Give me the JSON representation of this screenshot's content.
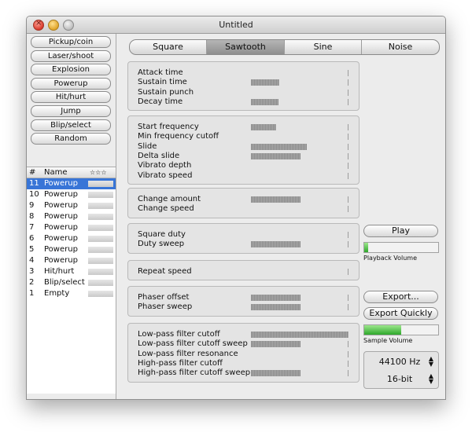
{
  "window": {
    "title": "Untitled"
  },
  "generators": [
    "Pickup/coin",
    "Laser/shoot",
    "Explosion",
    "Powerup",
    "Hit/hurt",
    "Jump",
    "Blip/select",
    "Random"
  ],
  "sound_list": {
    "headers": {
      "num": "#",
      "name": "Name",
      "rating": "☆☆☆"
    },
    "rows": [
      {
        "num": "11",
        "name": "Powerup"
      },
      {
        "num": "10",
        "name": "Powerup"
      },
      {
        "num": "9",
        "name": "Powerup"
      },
      {
        "num": "8",
        "name": "Powerup"
      },
      {
        "num": "7",
        "name": "Powerup"
      },
      {
        "num": "6",
        "name": "Powerup"
      },
      {
        "num": "5",
        "name": "Powerup"
      },
      {
        "num": "4",
        "name": "Powerup"
      },
      {
        "num": "3",
        "name": "Hit/hurt"
      },
      {
        "num": "2",
        "name": "Blip/select"
      },
      {
        "num": "1",
        "name": "Empty"
      }
    ],
    "selected_index": 0,
    "remove_label": "−"
  },
  "waveforms": [
    "Square",
    "Sawtooth",
    "Sine",
    "Noise"
  ],
  "selected_waveform": 1,
  "groups": [
    {
      "params": [
        {
          "label": "Attack time",
          "value": 0
        },
        {
          "label": "Sustain time",
          "value": 0.29
        },
        {
          "label": "Sustain punch",
          "value": 0
        },
        {
          "label": "Decay time",
          "value": 0.28
        }
      ]
    },
    {
      "params": [
        {
          "label": "Start frequency",
          "value": 0.26
        },
        {
          "label": "Min frequency cutoff",
          "value": 0
        },
        {
          "label": "Slide",
          "value": 0.57,
          "center": true
        },
        {
          "label": "Delta slide",
          "value": 0.5,
          "center": true
        },
        {
          "label": "Vibrato depth",
          "value": 0
        },
        {
          "label": "Vibrato speed",
          "value": 0
        }
      ]
    },
    {
      "params": [
        {
          "label": "Change amount",
          "value": 0.5,
          "center": true
        },
        {
          "label": "Change speed",
          "value": 0
        }
      ]
    },
    {
      "params": [
        {
          "label": "Square duty",
          "value": 0
        },
        {
          "label": "Duty sweep",
          "value": 0.5,
          "center": true
        }
      ]
    },
    {
      "params": [
        {
          "label": "Repeat speed",
          "value": 0
        }
      ]
    },
    {
      "params": [
        {
          "label": "Phaser offset",
          "value": 0.5,
          "center": true
        },
        {
          "label": "Phaser sweep",
          "value": 0.5,
          "center": true
        }
      ]
    },
    {
      "params": [
        {
          "label": "Low-pass filter cutoff",
          "value": 1.0
        },
        {
          "label": "Low-pass filter cutoff sweep",
          "value": 0.5,
          "center": true
        },
        {
          "label": "Low-pass filter resonance",
          "value": 0
        },
        {
          "label": "High-pass filter cutoff",
          "value": 0
        },
        {
          "label": "High-pass filter cutoff sweep",
          "value": 0.5,
          "center": true
        }
      ]
    }
  ],
  "controls": {
    "play_label": "Play",
    "playback_volume_label": "Playback Volume",
    "playback_volume": 0.05,
    "export_label": "Export...",
    "export_quickly_label": "Export Quickly",
    "sample_volume_label": "Sample Volume",
    "sample_volume": 0.5,
    "sample_rate": "44100 Hz",
    "bit_depth": "16-bit"
  }
}
